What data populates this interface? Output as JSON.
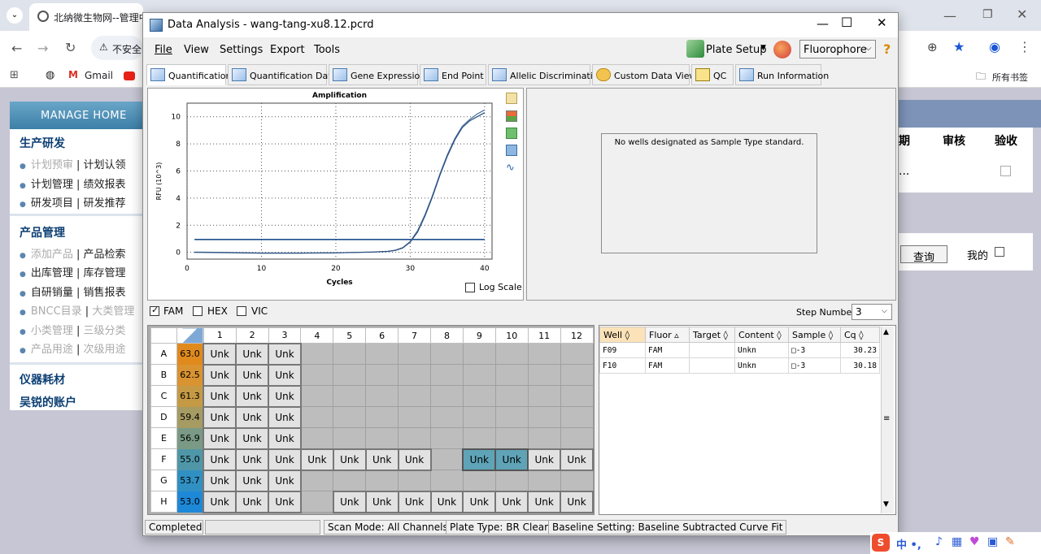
{
  "browser": {
    "tab_title": "北纳微生物网--管理中",
    "security_label": "不安全",
    "bookmark_gmail": "Gmail",
    "bookmarks_all": "所有书签"
  },
  "site": {
    "logo": "MANAGE HOME",
    "sections": [
      {
        "title": "生产研发",
        "lines": [
          [
            "计划预审",
            "计划认领"
          ],
          [
            "计划管理",
            "绩效报表"
          ],
          [
            "研发项目",
            "研发推荐"
          ]
        ]
      },
      {
        "title": "产品管理",
        "lines": [
          [
            "添加产品",
            "产品检索"
          ],
          [
            "出库管理",
            "库存管理"
          ],
          [
            "自研销量",
            "销售报表"
          ],
          [
            "BNCC目录",
            "大类管理"
          ],
          [
            "小类管理",
            "三级分类"
          ],
          [
            "产品用途",
            "次级用途"
          ]
        ]
      }
    ],
    "links": [
      "仪器耗材",
      "吴锐的账户"
    ],
    "right_headers": [
      "期",
      "审核",
      "验收"
    ],
    "right_ellipsis": "...",
    "query_button": "查询",
    "mine_label": "我的"
  },
  "app": {
    "title": "Data Analysis - wang-tang-xu8.12.pcrd",
    "menus": [
      "File",
      "View",
      "Settings",
      "Export",
      "Tools"
    ],
    "plate_setup": "Plate Setup",
    "fluorophore": "Fluorophore",
    "help": "?",
    "tabs": [
      "Quantification",
      "Quantification Data",
      "Gene Expression",
      "End Point",
      "Allelic Discrimination",
      "Custom Data View",
      "QC",
      "Run Information"
    ],
    "no_standard_msg": "No wells designated as Sample Type standard.",
    "log_scale": "Log Scale",
    "fluors": [
      "FAM",
      "HEX",
      "VIC"
    ],
    "step_label": "Step Number:",
    "step_value": "3",
    "status": {
      "completed": "Completed",
      "scan": "Scan Mode: All Channels",
      "plate": "Plate Type: BR Clear",
      "baseline": "Baseline Setting: Baseline Subtracted Curve Fit"
    }
  },
  "chart_data": {
    "type": "line",
    "title": "Amplification",
    "xlabel": "Cycles",
    "ylabel": "RFU (10^3)",
    "xlim": [
      0,
      41
    ],
    "ylim": [
      -0.5,
      11
    ],
    "xticks": [
      0,
      10,
      20,
      30,
      40
    ],
    "yticks": [
      0,
      2,
      4,
      6,
      8,
      10
    ],
    "grid": true,
    "threshold": 0.95,
    "series": [
      {
        "x": [
          1,
          5,
          10,
          15,
          20,
          25,
          27,
          28,
          29,
          30,
          31,
          32,
          33,
          34,
          35,
          36,
          37,
          38,
          39,
          40
        ],
        "y": [
          0.02,
          0.0,
          -0.05,
          -0.05,
          -0.03,
          0.03,
          0.08,
          0.16,
          0.35,
          0.8,
          1.6,
          2.8,
          4.2,
          5.8,
          7.2,
          8.4,
          9.3,
          9.8,
          10.2,
          10.5
        ]
      },
      {
        "x": [
          1,
          5,
          10,
          15,
          20,
          25,
          27,
          28,
          29,
          30,
          31,
          32,
          33,
          34,
          35,
          36,
          37,
          38,
          39,
          40
        ],
        "y": [
          0.0,
          -0.02,
          -0.06,
          -0.06,
          -0.04,
          0.02,
          0.07,
          0.14,
          0.32,
          0.75,
          1.5,
          2.7,
          4.1,
          5.7,
          7.1,
          8.3,
          9.2,
          9.7,
          10.0,
          10.3
        ]
      }
    ]
  },
  "plate": {
    "columns": [
      "1",
      "2",
      "3",
      "4",
      "5",
      "6",
      "7",
      "8",
      "9",
      "10",
      "11",
      "12"
    ],
    "rows": [
      {
        "label": "A",
        "temp": "63.0",
        "color": "#e08a1e",
        "cells": [
          "Unk",
          "Unk",
          "Unk",
          "",
          "",
          "",
          "",
          "",
          "",
          "",
          "",
          ""
        ]
      },
      {
        "label": "B",
        "temp": "62.5",
        "color": "#d99330",
        "cells": [
          "Unk",
          "Unk",
          "Unk",
          "",
          "",
          "",
          "",
          "",
          "",
          "",
          "",
          ""
        ]
      },
      {
        "label": "C",
        "temp": "61.3",
        "color": "#c59a45",
        "cells": [
          "Unk",
          "Unk",
          "Unk",
          "",
          "",
          "",
          "",
          "",
          "",
          "",
          "",
          ""
        ]
      },
      {
        "label": "D",
        "temp": "59.4",
        "color": "#a59b63",
        "cells": [
          "Unk",
          "Unk",
          "Unk",
          "",
          "",
          "",
          "",
          "",
          "",
          "",
          "",
          ""
        ]
      },
      {
        "label": "E",
        "temp": "56.9",
        "color": "#7a9a86",
        "cells": [
          "Unk",
          "Unk",
          "Unk",
          "",
          "",
          "",
          "",
          "",
          "",
          "",
          "",
          ""
        ]
      },
      {
        "label": "F",
        "temp": "55.0",
        "color": "#4f97a8",
        "cells": [
          "Unk",
          "Unk",
          "Unk",
          "Unk",
          "Unk",
          "Unk",
          "Unk",
          "",
          "Unk",
          "Unk",
          "Unk",
          "Unk"
        ]
      },
      {
        "label": "G",
        "temp": "53.7",
        "color": "#3090c2",
        "cells": [
          "Unk",
          "Unk",
          "Unk",
          "",
          "",
          "",
          "",
          "",
          "",
          "",
          "",
          ""
        ]
      },
      {
        "label": "H",
        "temp": "53.0",
        "color": "#1e88d8",
        "cells": [
          "Unk",
          "Unk",
          "Unk",
          "",
          "Unk",
          "Unk",
          "Unk",
          "Unk",
          "Unk",
          "Unk",
          "Unk",
          "Unk"
        ]
      }
    ],
    "selected": [
      [
        "F",
        9
      ],
      [
        "F",
        10
      ]
    ]
  },
  "wells": {
    "headers": [
      "Well",
      "Fluor",
      "Target",
      "Content",
      "Sample",
      "Cq"
    ],
    "rows": [
      [
        "F09",
        "FAM",
        "",
        "Unkn",
        "□-3",
        "30.23"
      ],
      [
        "F10",
        "FAM",
        "",
        "Unkn",
        "□-3",
        "30.18"
      ]
    ]
  }
}
